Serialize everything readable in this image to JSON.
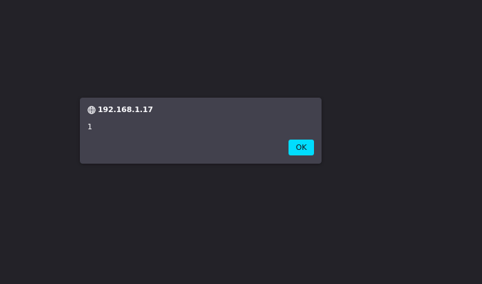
{
  "dialog": {
    "origin": "192.168.1.17",
    "origin_icon": "globe-icon",
    "message": "1",
    "ok_label": "OK"
  },
  "colors": {
    "background": "#232228",
    "dialog_background": "#42414d",
    "text": "#fbfbfe",
    "accent": "#00ddff",
    "button_text": "#15141a"
  }
}
